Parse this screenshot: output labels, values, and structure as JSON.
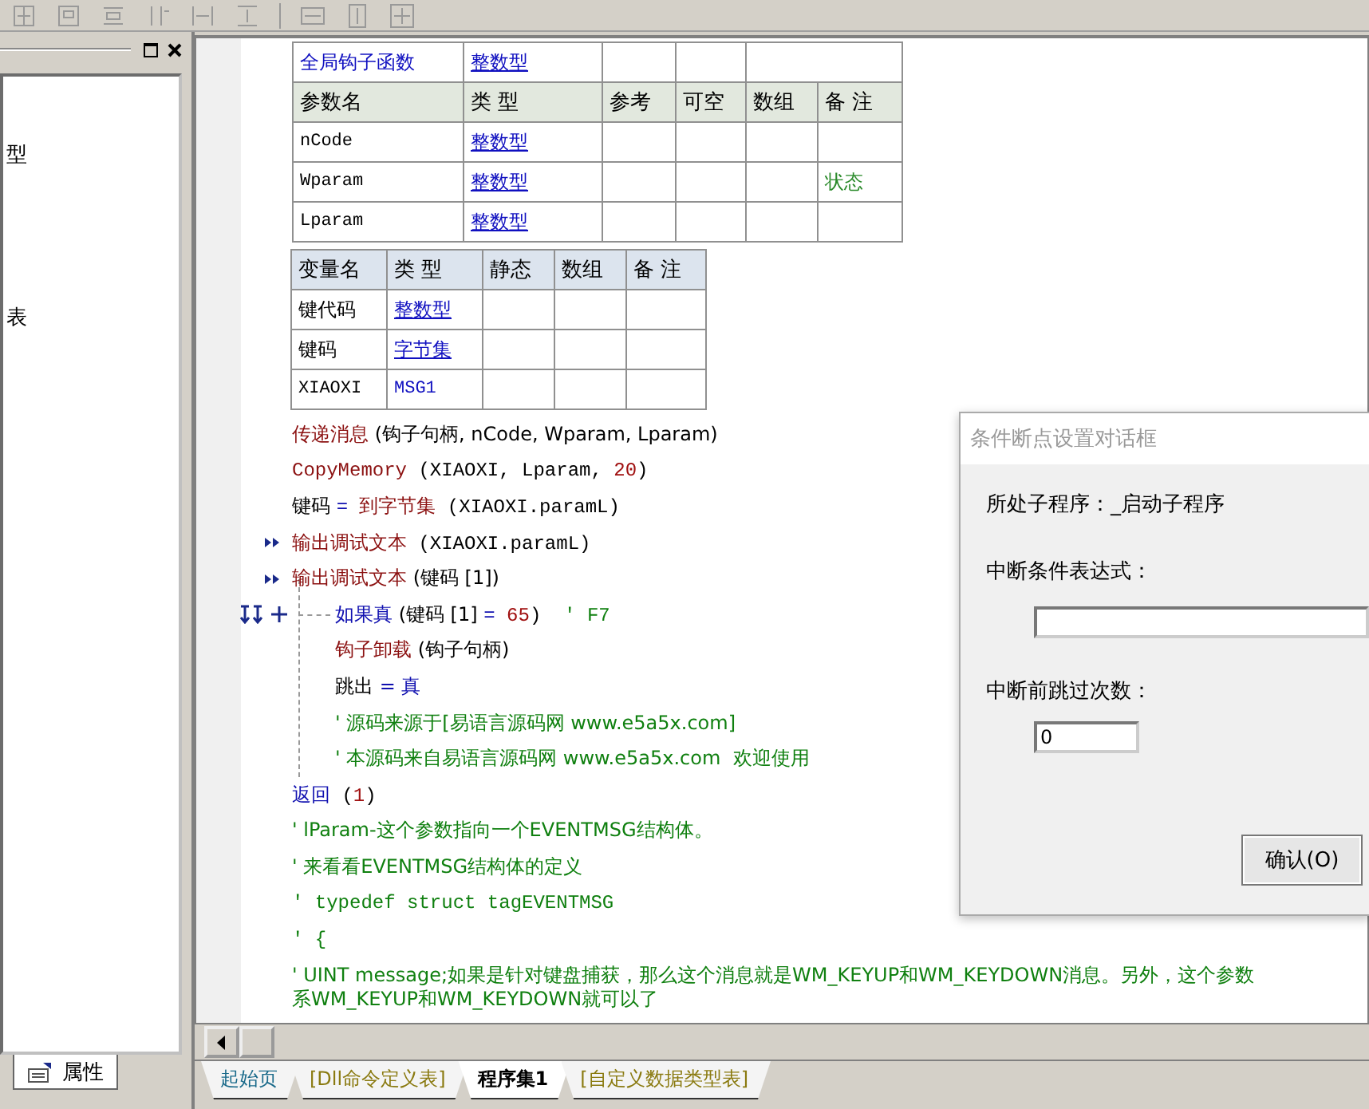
{
  "sidebar": {
    "items": [
      {
        "label": "型"
      },
      {
        "label": "表"
      }
    ],
    "tab": {
      "label": "属性"
    }
  },
  "sub_table": {
    "name": "全局钩子函数",
    "return_type": "整数型",
    "columns": [
      "参数名",
      "类 型",
      "参考",
      "可空",
      "数组",
      "备 注"
    ],
    "rows": [
      {
        "name": "nCode",
        "type": "整数型"
      },
      {
        "name": "Wparam",
        "type": "整数型",
        "note": "状态"
      },
      {
        "name": "Lparam",
        "type": "整数型"
      }
    ]
  },
  "var_table": {
    "columns": [
      "变量名",
      "类 型",
      "静态",
      "数组",
      "备 注"
    ],
    "rows": [
      {
        "name": "键代码",
        "type": "整数型"
      },
      {
        "name": "键码",
        "type": "字节集"
      },
      {
        "name": "XIAOXI",
        "type": "MSG1"
      }
    ]
  },
  "code_lines": [
    {
      "segments": [
        {
          "text": "传递消息",
          "kind": "call"
        },
        {
          "text": " (钩子句柄, nCode, Wparam, Lparam)",
          "kind": "plain"
        }
      ]
    },
    {
      "segments": [
        {
          "text": "CopyMemory",
          "kind": "call"
        },
        {
          "text": " (XIAOXI, Lparam, ",
          "kind": "plain"
        },
        {
          "text": "20",
          "kind": "number"
        },
        {
          "text": ")",
          "kind": "plain"
        }
      ]
    },
    {
      "segments": [
        {
          "text": "键码 ",
          "kind": "plain"
        },
        {
          "text": "= ",
          "kind": "keyword"
        },
        {
          "text": "到字节集",
          "kind": "call"
        },
        {
          "text": " (XIAOXI.paramL)",
          "kind": "plain"
        }
      ]
    },
    {
      "debug_output": true,
      "segments": [
        {
          "text": "输出调试文本",
          "kind": "call"
        },
        {
          "text": " (XIAOXI.paramL)",
          "kind": "plain"
        }
      ]
    },
    {
      "debug_output": true,
      "segments": [
        {
          "text": "输出调试文本",
          "kind": "call"
        },
        {
          "text": " (键码 [1])",
          "kind": "plain"
        }
      ]
    },
    {
      "breakpoint": true,
      "segments": [
        {
          "text": "如果真",
          "kind": "keyword"
        },
        {
          "text": " (键码 [1] ",
          "kind": "plain"
        },
        {
          "text": "= ",
          "kind": "keyword"
        },
        {
          "text": "65",
          "kind": "number"
        },
        {
          "text": ")  ",
          "kind": "plain"
        },
        {
          "text": "' F7",
          "kind": "comment"
        }
      ],
      "children": [
        {
          "segments": [
            {
              "text": "钩子卸载",
              "kind": "call"
            },
            {
              "text": " (钩子句柄)",
              "kind": "plain"
            }
          ]
        },
        {
          "segments": [
            {
              "text": "跳出 ",
              "kind": "plain"
            },
            {
              "text": "= 真",
              "kind": "keyword"
            }
          ]
        },
        {
          "segments": [
            {
              "text": "' 源码来源于[易语言源码网 www.e5a5x.com]",
              "kind": "comment"
            }
          ]
        },
        {
          "segments": [
            {
              "text": "' 本源码来自易语言源码网 www.e5a5x.com  欢迎使用",
              "kind": "comment"
            }
          ]
        }
      ]
    },
    {
      "segments": [
        {
          "text": "返回",
          "kind": "keyword"
        },
        {
          "text": " (",
          "kind": "plain"
        },
        {
          "text": "1",
          "kind": "number"
        },
        {
          "text": ")",
          "kind": "plain"
        }
      ]
    },
    {
      "segments": [
        {
          "text": "' lParam-这个参数指向一个EVENTMSG结构体。",
          "kind": "comment"
        }
      ]
    },
    {
      "segments": [
        {
          "text": "' 来看看EVENTMSG结构体的定义",
          "kind": "comment"
        }
      ]
    },
    {
      "segments": [
        {
          "text": "' typedef struct tagEVENTMSG",
          "kind": "comment"
        }
      ]
    },
    {
      "segments": [
        {
          "text": "' {",
          "kind": "comment"
        }
      ]
    },
    {
      "segments": [
        {
          "text": "' UINT message;如果是针对键盘捕获，那么这个消息就是WM_KEYUP和WM_KEYDOWN消息。另外，这个参数",
          "kind": "comment"
        }
      ]
    },
    {
      "segments": [
        {
          "text": "系WM_KEYUP和WM_KEYDOWN就可以了",
          "kind": "comment"
        }
      ],
      "wrapped": true
    }
  ],
  "tabs": [
    {
      "label": "起始页",
      "color": "#1a6a8a",
      "selected": false
    },
    {
      "label": "[Dll命令定义表]",
      "color": "#8a7a10",
      "selected": false
    },
    {
      "label": "程序集1",
      "color": "#000000",
      "selected": true
    },
    {
      "label": "[自定义数据类型表]",
      "color": "#8a7a10",
      "selected": false
    }
  ],
  "dialog": {
    "title": "条件断点设置对话框",
    "subroutine": "所处子程序：_启动子程序",
    "condition_label": "中断条件表达式：",
    "skip_label": "中断前跳过次数：",
    "skip_value": "0",
    "button": "确认(O)"
  }
}
